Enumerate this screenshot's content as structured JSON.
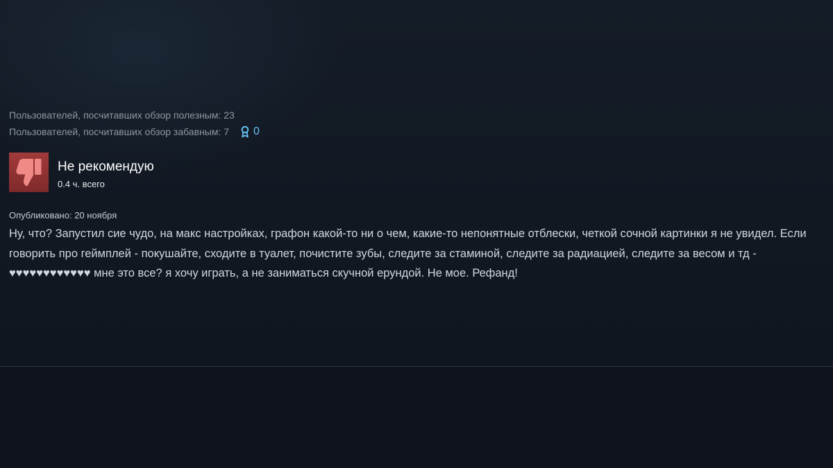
{
  "review": {
    "helpful_line": "Пользователей, посчитавших обзор полезным: 23",
    "funny_line": "Пользователей, посчитавших обзор забавным: 7",
    "awards_count": "0",
    "verdict": "Не рекомендую",
    "hours": "0.4 ч. всего",
    "posted": "Опубликовано: 20 ноября",
    "body": "Ну, что? Запустил сие чудо, на макс настройках, графон какой-то ни о чем, какие-то непонятные отблески, четкой сочной картинки я не увидел. Если говорить про геймплей - покушайте, сходите в туалет, почистите зубы, следите за стаминой, следите за радиацией, следите за весом и тд - ♥♥♥♥♥♥♥♥♥♥♥♥ мне это все? я хочу играть, а не заниматься скучной ерундой. Не мое. Рефанд!"
  },
  "icons": {
    "award": "award-ribbon-icon",
    "verdict": "thumbs-down-icon"
  },
  "colors": {
    "background": "#111721",
    "muted_text": "#8f98a0",
    "award_accent": "#66c0f4",
    "thumb_bg": "#a23a3a"
  }
}
